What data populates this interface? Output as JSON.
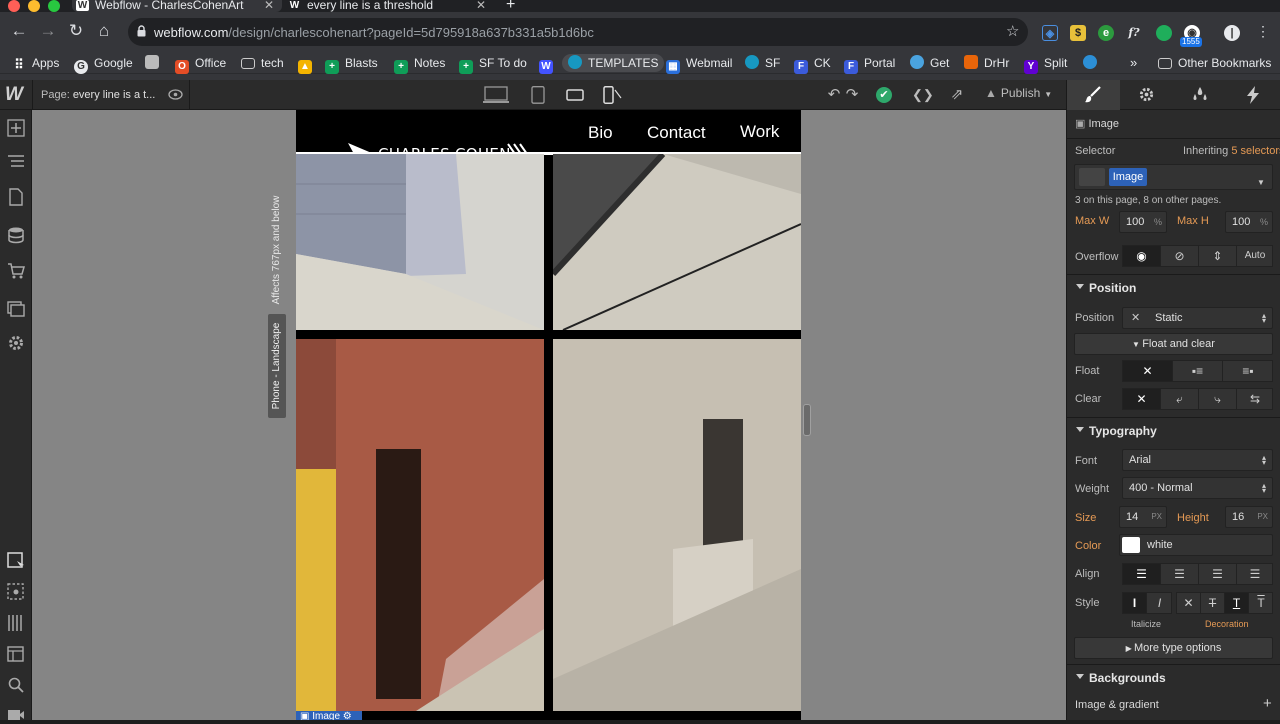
{
  "browser": {
    "tabs": [
      {
        "title": "Webflow - CharlesCohenArt",
        "active": true
      },
      {
        "title": "every line is a threshold",
        "active": false
      }
    ],
    "url_host": "webflow.com",
    "url_path": "/design/charlescohenart?pageId=5d795918a637b331a5b1d6bc",
    "extension_badge": "1555",
    "bookmarks": [
      {
        "label": "Apps",
        "icon": "apps-grid-icon"
      },
      {
        "label": "Google",
        "icon": "google-icon"
      },
      {
        "label": "",
        "icon": "printer-icon"
      },
      {
        "label": "Office",
        "icon": "office-icon"
      },
      {
        "label": "tech",
        "icon": "folder-icon"
      },
      {
        "label": "",
        "icon": "drive-icon"
      },
      {
        "label": "Blasts",
        "icon": "sheets-icon"
      },
      {
        "label": "Notes",
        "icon": "sheets-icon"
      },
      {
        "label": "SF To do",
        "icon": "sheets-icon"
      },
      {
        "label": "",
        "icon": "webflow-icon"
      },
      {
        "label": "TEMPLATES",
        "icon": "salesforce-icon"
      },
      {
        "label": "Webmail",
        "icon": "grid-icon"
      },
      {
        "label": "SF",
        "icon": "salesforce-icon"
      },
      {
        "label": "CK",
        "icon": "flag-icon"
      },
      {
        "label": "Portal",
        "icon": "flag-icon"
      },
      {
        "label": "Get",
        "icon": "cloud-icon"
      },
      {
        "label": "DrHr",
        "icon": "orange-icon"
      },
      {
        "label": "Split",
        "icon": "yahoo-icon"
      },
      {
        "label": "",
        "icon": "globe-icon"
      }
    ],
    "other_bookmarks": "Other Bookmarks"
  },
  "webflow": {
    "page_label": "Page:",
    "page_name": "every line is a t...",
    "publish_label": "Publish"
  },
  "canvas": {
    "breakpoint_label": "Affects 767px and below",
    "breakpoint_tab": "Phone - Landscape",
    "selected_tag": "Image",
    "site": {
      "logo_text": "CHARLES COHEN",
      "nav": [
        "Bio",
        "Contact",
        "Work"
      ]
    }
  },
  "panel": {
    "element_type": "Image",
    "selector_label": "Selector",
    "inheriting_prefix": "Inheriting",
    "inheriting_link": "5 selectors",
    "selector_chip": "Image",
    "selector_note": "3 on this page, 8 on other pages.",
    "max_w_label": "Max W",
    "max_w_value": "100",
    "max_w_unit": "%",
    "max_h_label": "Max H",
    "max_h_value": "100",
    "max_h_unit": "%",
    "overflow_label": "Overflow",
    "overflow_auto": "Auto",
    "position_section": "Position",
    "position_label": "Position",
    "position_value": "Static",
    "float_clear_toggle": "Float and clear",
    "float_label": "Float",
    "clear_label": "Clear",
    "typography_section": "Typography",
    "font_label": "Font",
    "font_value": "Arial",
    "weight_label": "Weight",
    "weight_value": "400 - Normal",
    "size_label": "Size",
    "size_value": "14",
    "size_unit": "PX",
    "height_label": "Height",
    "height_value": "16",
    "height_unit": "PX",
    "color_label": "Color",
    "color_value": "white",
    "align_label": "Align",
    "style_label": "Style",
    "italicize_label": "Italicize",
    "decoration_label": "Decoration",
    "more_type": "More type options",
    "backgrounds_section": "Backgrounds",
    "image_gradient_label": "Image & gradient"
  },
  "colors": {
    "accent_blue": "#2d62b8",
    "orange_label": "#e59a55",
    "publish_green": "#2ea86b"
  }
}
